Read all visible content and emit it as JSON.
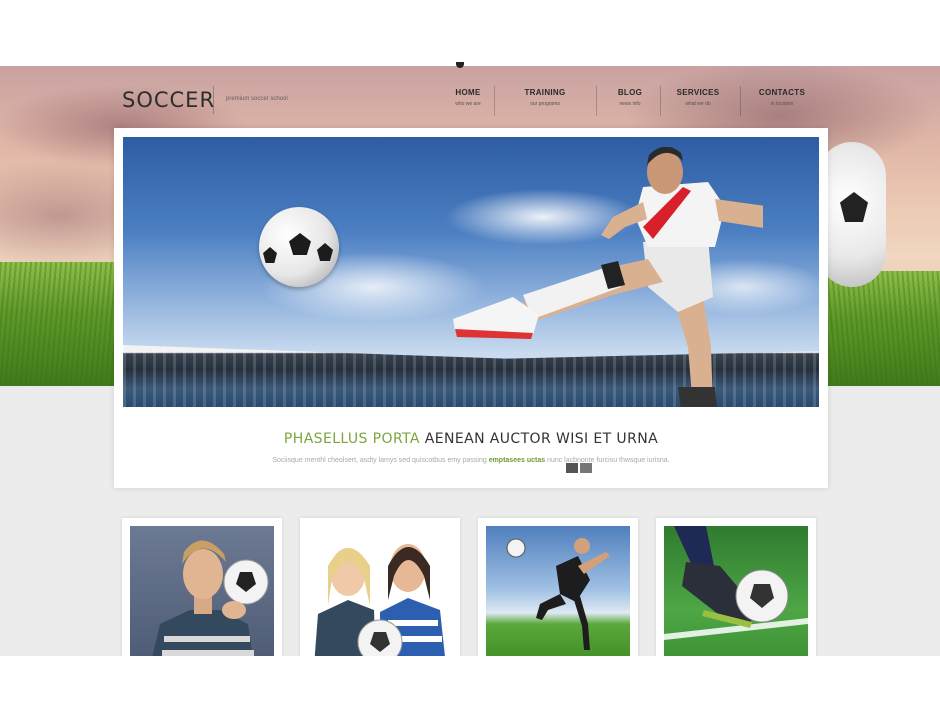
{
  "header": {
    "logo": "SOCCER",
    "tagline": "premium soccer school"
  },
  "nav": [
    {
      "label": "HOME",
      "sub": "who we are"
    },
    {
      "label": "TRAINING",
      "sub": "our programs"
    },
    {
      "label": "BLOG",
      "sub": "news info"
    },
    {
      "label": "SERVICES",
      "sub": "what we do"
    },
    {
      "label": "CONTACTS",
      "sub": "in location"
    }
  ],
  "slider": {
    "title_accent": "PHASELLUS PORTA",
    "title_rest": " AENEAN AUCTOR WISI ET URNA",
    "text_before": "Sociisque menthl cheolsert, asdty lamys sed quiscotbus emy passing ",
    "text_accent": "emptasees uctas",
    "text_after": " nunc lacbnonte furcisu thwsque iurisna.",
    "dots": 2,
    "active_dot": 0
  },
  "colors": {
    "accent": "#7aa63a",
    "background": "#ececec"
  }
}
